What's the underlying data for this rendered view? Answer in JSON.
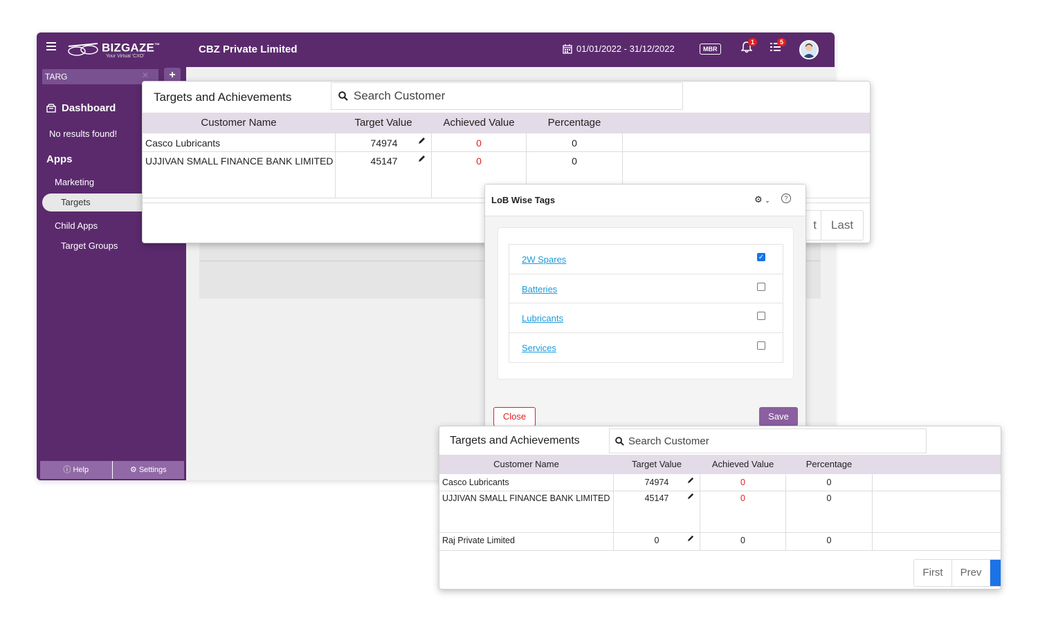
{
  "app": {
    "logo_text": "BIZGAZE",
    "logo_tm": "™",
    "logo_tagline": "Your Virtual 'CXO'",
    "company": "CBZ Private Limited",
    "date_range": "01/01/2022 - 31/12/2022",
    "mbr_label": "MBR",
    "notifications_count": "1",
    "tasks_count": "5"
  },
  "sidebar": {
    "search_value": "TARG",
    "dashboard_label": "Dashboard",
    "no_results": "No results found!",
    "apps_label": "Apps",
    "marketing_label": "Marketing",
    "targets_label": "Targets",
    "child_apps_label": "Child Apps",
    "target_groups_label": "Target Groups",
    "help_label": "Help",
    "settings_label": "Settings"
  },
  "targets_modal": {
    "title": "Targets and Achievements",
    "search_placeholder": "Search Customer",
    "columns": [
      "Customer Name",
      "Target Value",
      "Achieved Value",
      "Percentage"
    ],
    "rows": [
      {
        "customer": "Casco Lubricants",
        "target": "74974",
        "achieved": "0",
        "percentage": "0"
      },
      {
        "customer": "UJJIVAN SMALL FINANCE BANK LIMITED",
        "target": "45147",
        "achieved": "0",
        "percentage": "0"
      }
    ],
    "pager": [
      "t",
      "Last"
    ]
  },
  "lob_modal": {
    "title": "LoB Wise Tags",
    "tags": [
      {
        "label": "2W Spares",
        "checked": true
      },
      {
        "label": "Batteries",
        "checked": false
      },
      {
        "label": "Lubricants",
        "checked": false
      },
      {
        "label": "Services",
        "checked": false
      }
    ],
    "close_label": "Close",
    "save_label": "Save"
  },
  "targets_modal_2": {
    "title": "Targets and Achievements",
    "search_placeholder": "Search Customer",
    "columns": [
      "Customer Name",
      "Target Value",
      "Achieved Value",
      "Percentage"
    ],
    "rows": [
      {
        "customer": "Casco Lubricants",
        "target": "74974",
        "achieved": "0",
        "percentage": "0"
      },
      {
        "customer": "UJJIVAN SMALL FINANCE BANK LIMITED",
        "target": "45147",
        "achieved": "0",
        "percentage": "0"
      },
      {
        "customer": "Raj Private Limited",
        "target": "0",
        "achieved": "0",
        "percentage": "0"
      }
    ],
    "pager": [
      "First",
      "Prev"
    ]
  },
  "colors": {
    "brand_purple": "#5b2a6d",
    "header_row": "#e3dbe7",
    "link_blue": "#1a9bdc",
    "alert_red": "#e02020"
  }
}
